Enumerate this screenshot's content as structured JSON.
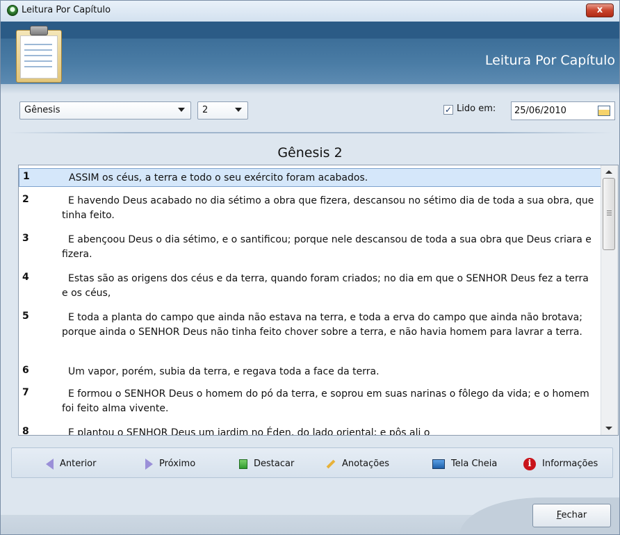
{
  "window": {
    "title": "Leitura Por Capítulo",
    "close_label": "x"
  },
  "header": {
    "title": "Leitura Por Capítulo"
  },
  "controls": {
    "book_select": "Gênesis",
    "chapter_select": "2",
    "read_checkbox_checked": true,
    "read_label": "Lido em:",
    "read_date": "25/06/2010"
  },
  "chapter_title": "Gênesis 2",
  "verses": [
    {
      "num": "1",
      "text": "ASSIM os céus, a terra e todo o seu exército foram acabados."
    },
    {
      "num": "2",
      "text": "E havendo Deus acabado no dia sétimo a obra que fizera, descansou no sétimo dia de toda a sua obra, que tinha feito."
    },
    {
      "num": "3",
      "text": "E abençoou Deus o dia sétimo, e o santificou; porque nele descansou de toda a sua obra que Deus criara e fizera."
    },
    {
      "num": "4",
      "text": "Estas são as origens dos céus e da terra, quando foram criados; no dia em que o SENHOR Deus fez a terra e os céus,"
    },
    {
      "num": "5",
      "text": "E toda a planta do campo que ainda não estava na terra, e toda a erva do campo que ainda não brotava; porque ainda o SENHOR Deus não tinha feito chover sobre a terra, e não havia homem para lavrar a terra."
    },
    {
      "num": "6",
      "text": "Um vapor, porém, subia da terra, e regava toda a face da terra."
    },
    {
      "num": "7",
      "text": "E formou o SENHOR Deus o homem do pó da terra, e soprou em suas narinas o fôlego da vida; e o homem foi feito alma vivente."
    },
    {
      "num": "8",
      "text": "E plantou o SENHOR Deus um jardim no Éden, do lado oriental; e pôs ali o"
    }
  ],
  "toolbar": {
    "previous": "Anterior",
    "next": "Próximo",
    "highlight": "Destacar",
    "notes": "Anotações",
    "fullscreen": "Tela Cheia",
    "info": "Informações"
  },
  "footer": {
    "close_first_letter": "F",
    "close_rest": "echar"
  },
  "colors": {
    "banner": "#2b5b86",
    "selection": "#d5e7fa",
    "close_button": "#c9442c"
  }
}
